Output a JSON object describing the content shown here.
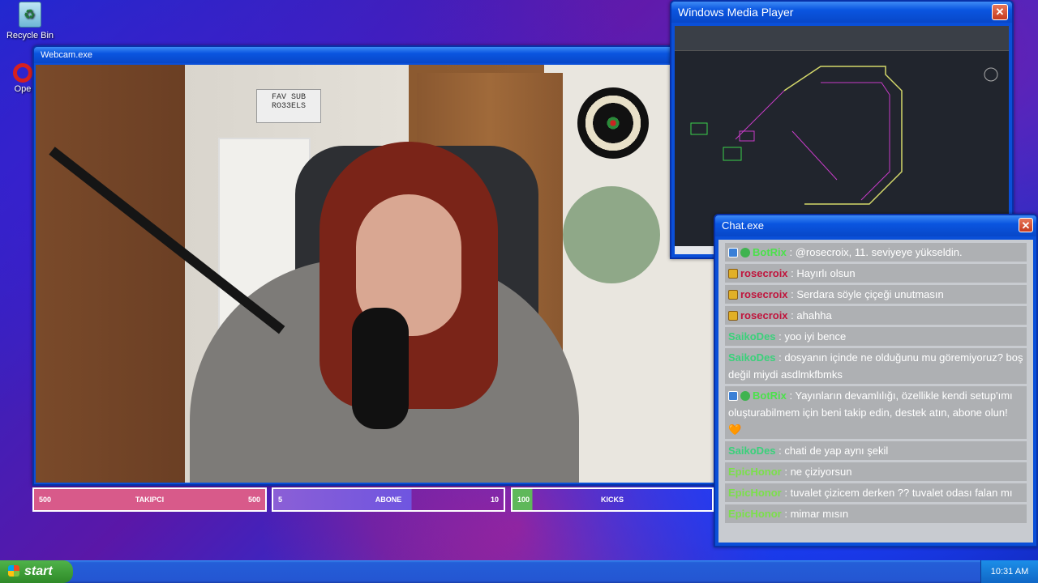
{
  "desktop": {
    "icons": [
      {
        "label": "Recycle Bin"
      },
      {
        "label": "Ope"
      }
    ]
  },
  "webcam_window": {
    "title": "Webcam.exe",
    "sign_text": "FAV SUB RO33ELS"
  },
  "wmp_window": {
    "title": "Windows Media Player"
  },
  "chat_window": {
    "title": "Chat.exe",
    "messages": [
      {
        "user": "BotRix",
        "user_color": "#4be14b",
        "badges": [
          "mod",
          "ver"
        ],
        "text": ": @rosecroix, 11. seviyeye yükseldin."
      },
      {
        "user": "rosecroix",
        "user_color": "#c0143c",
        "badges": [
          "sub"
        ],
        "text": ": Hayırlı olsun"
      },
      {
        "user": "rosecroix",
        "user_color": "#c0143c",
        "badges": [
          "sub"
        ],
        "text": ": Serdara söyle çiçeği unutmasın"
      },
      {
        "user": "rosecroix",
        "user_color": "#c0143c",
        "badges": [
          "sub"
        ],
        "text": ": ahahha"
      },
      {
        "user": "SaikoDes",
        "user_color": "#3ad17a",
        "badges": [],
        "text": ": yoo iyi bence"
      },
      {
        "user": "SaikoDes",
        "user_color": "#3ad17a",
        "badges": [],
        "text": ": dosyanın içinde ne olduğunu mu göremiyoruz? boş değil miydi asdlmkfbmks"
      },
      {
        "user": "BotRix",
        "user_color": "#4be14b",
        "badges": [
          "mod",
          "ver"
        ],
        "text": ": Yayınların devamlılığı, özellikle kendi setup'ımı oluşturabilmem için beni takip edin, destek atın, abone olun! 🧡"
      },
      {
        "user": "SaikoDes",
        "user_color": "#3ad17a",
        "badges": [],
        "text": ": chati de yap aynı şekil"
      },
      {
        "user": "EpicHonor",
        "user_color": "#7be04a",
        "badges": [],
        "text": ": ne çiziyorsun"
      },
      {
        "user": "EpicHonor",
        "user_color": "#7be04a",
        "badges": [],
        "text": ": tuvalet çizicem derken ?? tuvalet odası falan mı"
      },
      {
        "user": "EpicHonor",
        "user_color": "#7be04a",
        "badges": [],
        "text": ": mimar mısın"
      }
    ]
  },
  "goals": [
    {
      "left": "500",
      "label": "TAKIPCI",
      "right": "500",
      "progress": 1.0
    },
    {
      "left": "5",
      "label": "ABONE",
      "right": "10",
      "progress": 0.5
    },
    {
      "left": "100",
      "label": "KICKS",
      "right": "",
      "progress": 0.1
    }
  ],
  "taskbar": {
    "start_label": "start",
    "clock": "10:31 AM"
  }
}
